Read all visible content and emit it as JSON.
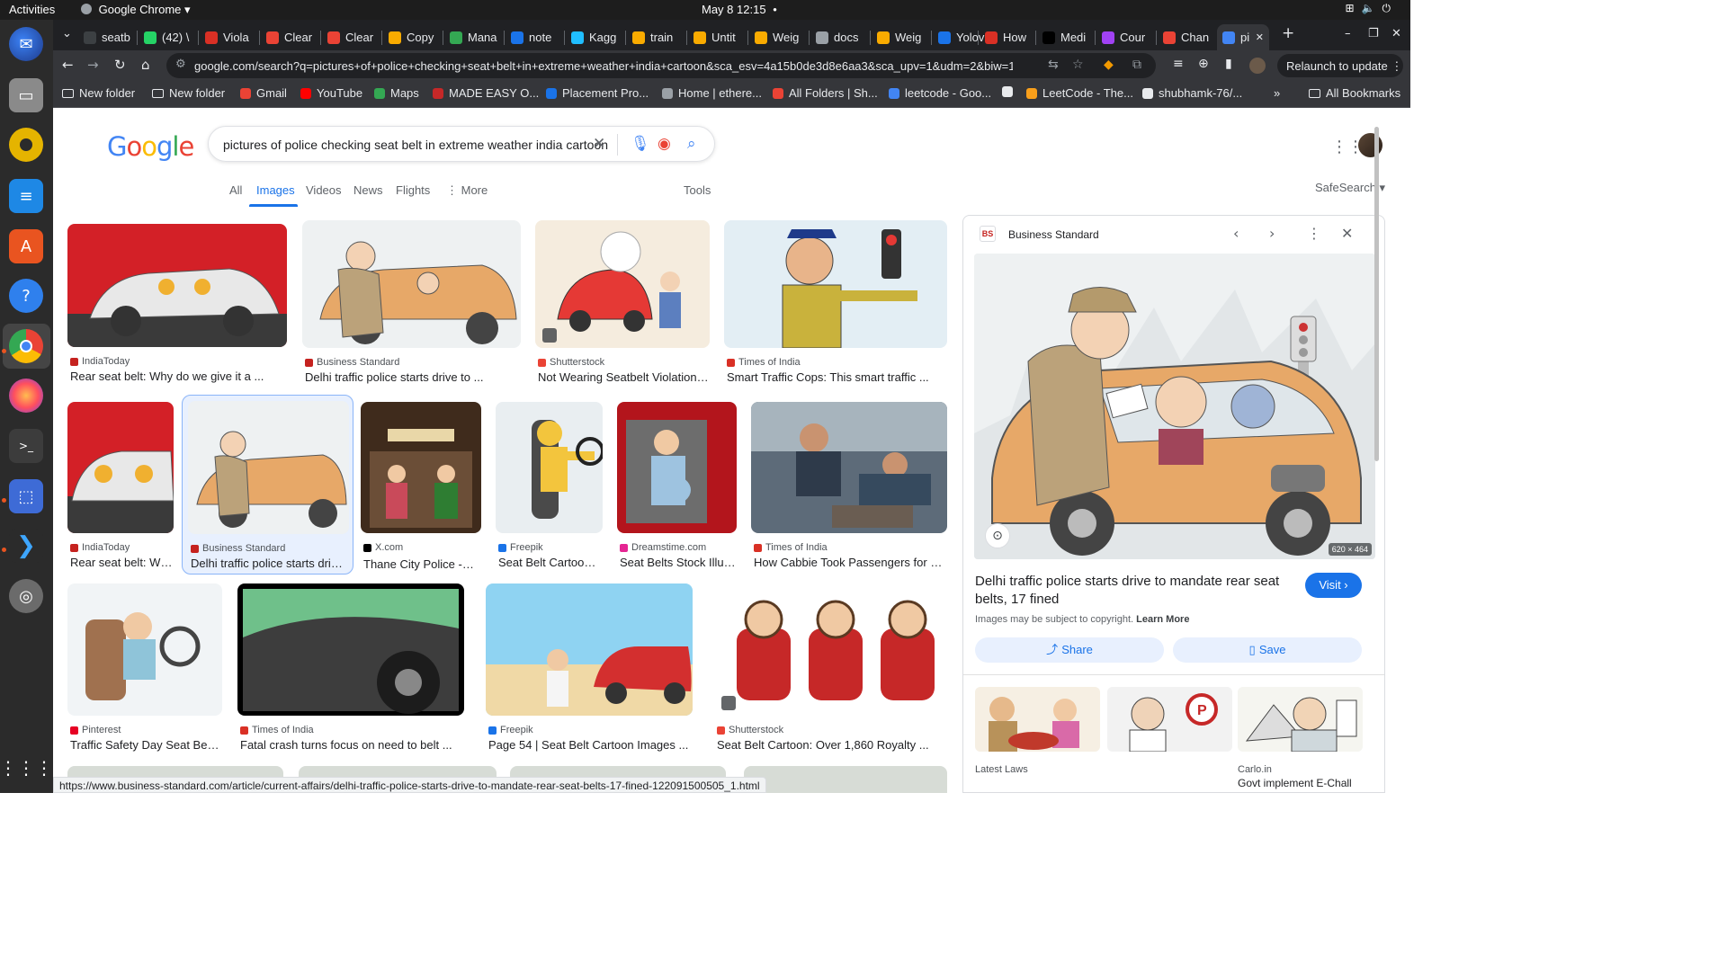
{
  "os": {
    "activities": "Activities",
    "app_name": "Google Chrome ▾",
    "clock": "May 8  12:15",
    "clock_dot": "●"
  },
  "dock": {
    "items": [
      "thunderbird-icon",
      "files-icon",
      "rhythmbox-icon",
      "writer-icon",
      "software-center-icon",
      "help-icon",
      "chrome-icon",
      "firefox-icon",
      "terminal-icon",
      "screenshot-icon",
      "vscode-icon",
      "disc-icon",
      "app-grid-icon"
    ]
  },
  "tabs": [
    {
      "label": "seatb",
      "color": "#3c4043"
    },
    {
      "label": "(42) \\",
      "color": "#25d366"
    },
    {
      "label": "Viola",
      "color": "#d93025"
    },
    {
      "label": "Clear",
      "color": "#ea4335"
    },
    {
      "label": "Clear",
      "color": "#ea4335"
    },
    {
      "label": "Copy",
      "color": "#f9ab00"
    },
    {
      "label": "Mana",
      "color": "#34a853"
    },
    {
      "label": "note",
      "color": "#1a73e8"
    },
    {
      "label": "Kagg",
      "color": "#20beff"
    },
    {
      "label": "train",
      "color": "#f9ab00"
    },
    {
      "label": "Untit",
      "color": "#f9ab00"
    },
    {
      "label": "Weig",
      "color": "#f9ab00"
    },
    {
      "label": "docs",
      "color": "#9aa0a6"
    },
    {
      "label": "Weig",
      "color": "#f9ab00"
    },
    {
      "label": "Yolov",
      "color": "#1a73e8"
    },
    {
      "label": "How",
      "color": "#d93025"
    },
    {
      "label": "Medi",
      "color": "#000000"
    },
    {
      "label": "Cour",
      "color": "#a142f4"
    },
    {
      "label": "Chan",
      "color": "#ea4335"
    },
    {
      "label": "pi",
      "color": "#4285f4"
    }
  ],
  "toolbar": {
    "url": "google.com/search?q=pictures+of+police+checking+seat+belt+in+extreme+weather+india+cartoon&sca_esv=4a15b0de3d8e6aa3&sca_upv=1&udm=2&biw=1848&bih=932&sxsrf=A...",
    "relaunch": "Relaunch to update  ⋮"
  },
  "bookmarks": [
    {
      "label": "New folder",
      "icon": "folder-icon"
    },
    {
      "label": "New folder",
      "icon": "folder-icon"
    },
    {
      "label": "Gmail",
      "icon": "gmail-icon"
    },
    {
      "label": "YouTube",
      "icon": "youtube-icon"
    },
    {
      "label": "Maps",
      "icon": "maps-icon"
    },
    {
      "label": "MADE EASY O...",
      "icon": "madeeasy-icon"
    },
    {
      "label": "Placement Pro...",
      "icon": "placement-icon"
    },
    {
      "label": "Home | ethere...",
      "icon": "ethereum-icon"
    },
    {
      "label": "All Folders | Sh...",
      "icon": "folders-icon"
    },
    {
      "label": "leetcode - Goo...",
      "icon": "google-icon"
    },
    {
      "label": "",
      "icon": "globe-icon"
    },
    {
      "label": "LeetCode - The...",
      "icon": "leetcode-icon"
    },
    {
      "label": "shubhamk-76/...",
      "icon": "github-icon"
    }
  ],
  "all_bookmarks": "All Bookmarks",
  "search": {
    "query": "pictures of police checking seat belt in extreme weather india cartoon",
    "tabs": [
      "All",
      "Images",
      "Videos",
      "News",
      "Flights",
      "⋮ More"
    ],
    "active_tab": "Images",
    "tools": "Tools",
    "safesearch": "SafeSearch ▾"
  },
  "results": [
    {
      "source": "IndiaToday",
      "title": "Rear seat belt: Why do we give it a ...",
      "color": "#c5221f"
    },
    {
      "source": "Business Standard",
      "title": "Delhi traffic police starts drive to ...",
      "color": "#c5221f"
    },
    {
      "source": "Shutterstock",
      "title": "Not Wearing Seatbelt Violation P...",
      "color": "#ea4335"
    },
    {
      "source": "Times of India",
      "title": "Smart Traffic Cops: This smart traffic ...",
      "color": "#d93025"
    },
    {
      "source": "IndiaToday",
      "title": "Rear seat belt: Wh...",
      "color": "#c5221f"
    },
    {
      "source": "Business Standard",
      "title": "Delhi traffic police starts drive...",
      "color": "#c5221f"
    },
    {
      "source": "X.com",
      "title": "Thane City Police -ठा...",
      "color": "#000000"
    },
    {
      "source": "Freepik",
      "title": "Seat Belt Cartoon I...",
      "color": "#1a73e8"
    },
    {
      "source": "Dreamstime.com",
      "title": "Seat Belts Stock Illust...",
      "color": "#e52592"
    },
    {
      "source": "Times of India",
      "title": "How Cabbie Took Passengers for Rid...",
      "color": "#d93025"
    },
    {
      "source": "Pinterest",
      "title": "Traffic Safety Day Seat Belt ...",
      "color": "#e60023"
    },
    {
      "source": "Times of India",
      "title": "Fatal crash turns focus on need to belt ...",
      "color": "#d93025"
    },
    {
      "source": "Freepik",
      "title": "Page 54 | Seat Belt Cartoon Images ...",
      "color": "#1a73e8"
    },
    {
      "source": "Shutterstock",
      "title": "Seat Belt Cartoon: Over 1,860 Royalty ...",
      "color": "#ea4335"
    }
  ],
  "panel": {
    "source": "Business Standard",
    "dimensions": "620 × 464",
    "title": "Delhi traffic police starts drive to mandate rear seat belts, 17 fined",
    "visit": "Visit ›",
    "copyright": "Images may be subject to copyright.",
    "learn_more": "Learn More",
    "share": "Share",
    "save": "Save",
    "related": [
      {
        "source": "Latest Laws",
        "title": ""
      },
      {
        "source": "",
        "title": ""
      },
      {
        "source": "Carlo.in",
        "title": "Govt implement E-Chall"
      }
    ]
  },
  "status_url": "https://www.business-standard.com/article/current-affairs/delhi-traffic-police-starts-drive-to-mandate-rear-seat-belts-17-fined-122091500505_1.html"
}
